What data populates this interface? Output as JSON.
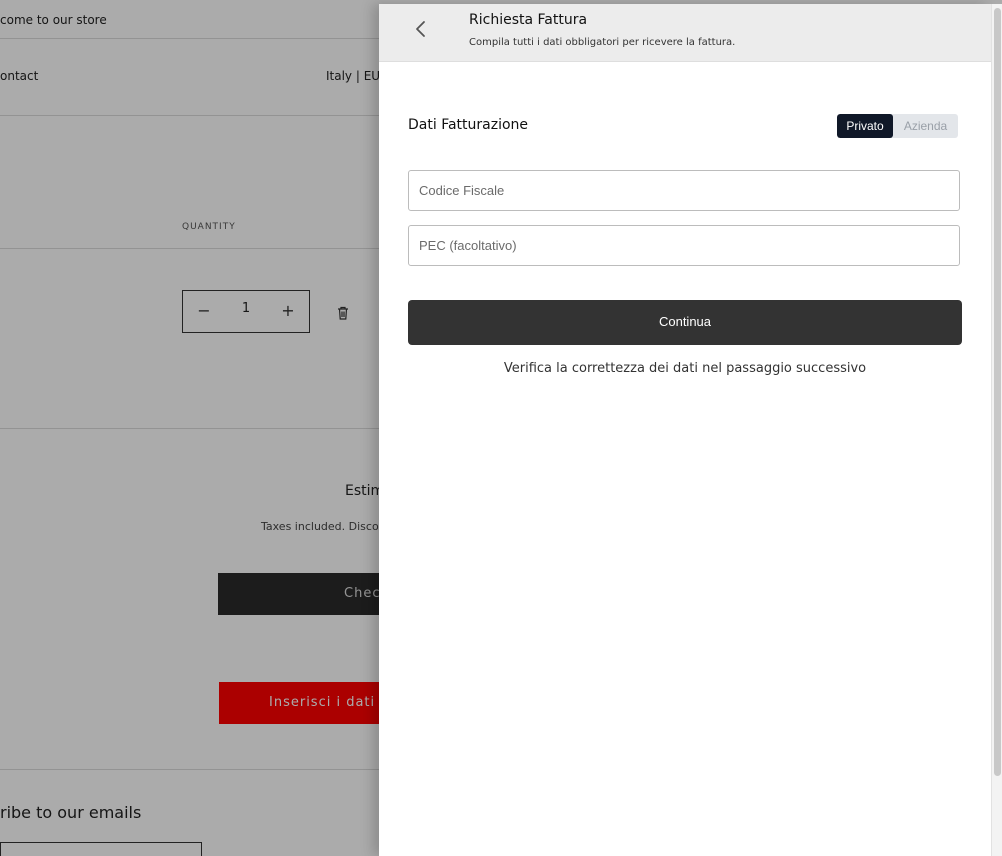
{
  "store": {
    "announcement": "come to our store",
    "nav_contact": "ontact",
    "locale": "Italy | EUI",
    "quantity_header": "QUANTITY",
    "quantity_value": "1",
    "minus": "−",
    "plus": "+",
    "estimated": "Estim",
    "taxes_note": "Taxes included. Discou",
    "checkout_label": "Check",
    "invoice_label": "Inserisci i dati pe",
    "subscribe_heading": "ribe to our emails"
  },
  "drawer": {
    "title": "Richiesta Fattura",
    "subtitle": "Compila tutti i dati obbligatori per ricevere la fattura.",
    "section_title": "Dati Fatturazione",
    "toggle": {
      "private": "Privato",
      "company": "Azienda",
      "selected": "Privato"
    },
    "fields": {
      "codice_fiscale_placeholder": "Codice Fiscale",
      "pec_placeholder": "PEC (facoltativo)"
    },
    "continue_label": "Continua",
    "note": "Verifica la correttezza dei dati nel passaggio successivo"
  },
  "icons": {
    "back": "chevron-left-icon",
    "trash": "trash-icon"
  },
  "colors": {
    "toggle_active": "#101828",
    "continue_button": "#333333",
    "invoice_button": "#ff0000"
  }
}
